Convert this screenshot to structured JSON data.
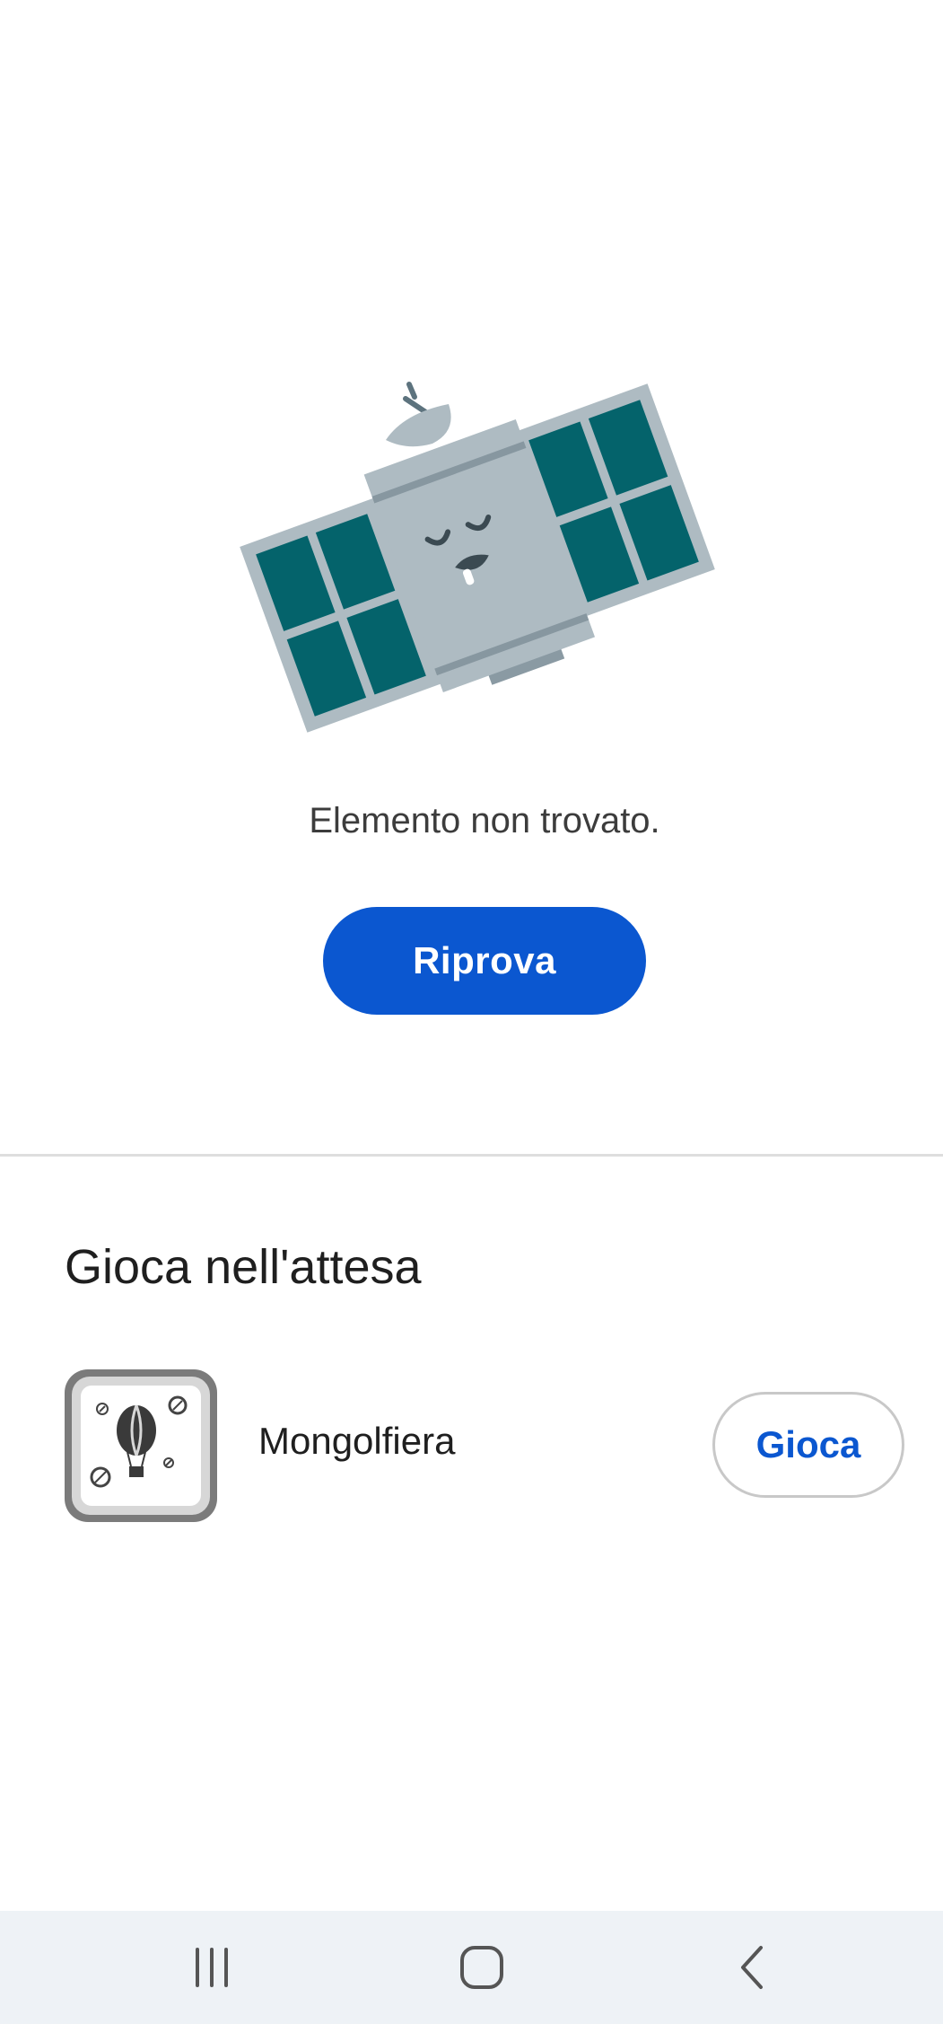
{
  "illustration": {
    "icon": "sleeping-satellite-illustration",
    "colors": {
      "body": "#aebbc2",
      "panel_frame": "#aebbc2",
      "panel_cell": "#04636b",
      "dark": "#5d737e",
      "face": "#3b4a52"
    }
  },
  "error": {
    "message": "Elemento non trovato."
  },
  "retry_button": {
    "label": "Riprova",
    "color": "#0b57d0"
  },
  "games": {
    "title": "Gioca nell'attesa",
    "items": [
      {
        "icon": "hot-air-balloon-icon",
        "name": "Mongolfiera",
        "action_label": "Gioca"
      }
    ]
  },
  "nav_bar": {
    "recents_icon": "recents-icon",
    "home_icon": "home-icon",
    "back_icon": "back-icon"
  }
}
